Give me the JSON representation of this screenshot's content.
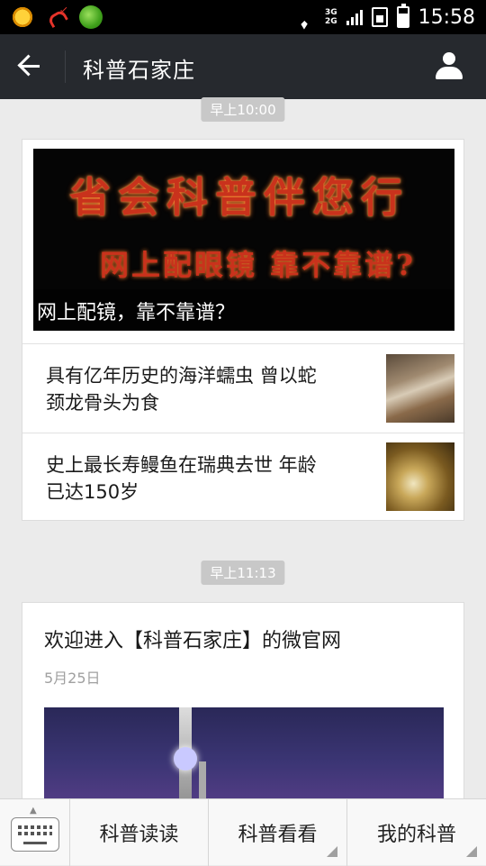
{
  "status_bar": {
    "time": "15:58",
    "network_top": "3G",
    "network_bottom": "2G",
    "icons": [
      "sun-icon",
      "missed-call-icon",
      "app-ball-icon",
      "wifi-icon",
      "signal-icon",
      "sim-icon",
      "battery-icon"
    ]
  },
  "header": {
    "title": "科普石家庄",
    "back_icon": "arrow-left-icon",
    "profile_icon": "person-icon"
  },
  "chat": {
    "messages": [
      {
        "time": "早上10:00",
        "banner_line1": "省会科普伴您行",
        "banner_line2": "网上配眼镜 靠不靠谱?",
        "banner_caption": "网上配镜，靠不靠谱？",
        "articles": [
          {
            "title_line1": "具有亿年历史的海洋蠕虫 曾以蛇",
            "title_line2": "颈龙骨头为食"
          },
          {
            "title_line1": "史上最长寿鳗鱼在瑞典去世 年龄",
            "title_line2": "已达150岁"
          }
        ]
      },
      {
        "time": "早上11:13",
        "title": "欢迎进入【科普石家庄】的微官网",
        "date": "5月25日"
      }
    ]
  },
  "bottom_menu": {
    "keyboard_icon": "keyboard-icon",
    "items": [
      "科普读读",
      "科普看看",
      "我的科普"
    ]
  },
  "colors": {
    "header_bg": "#26292e",
    "chat_bg": "#ebebeb",
    "time_pill": "#c8c8c8",
    "banner_text": "#c9321c"
  }
}
